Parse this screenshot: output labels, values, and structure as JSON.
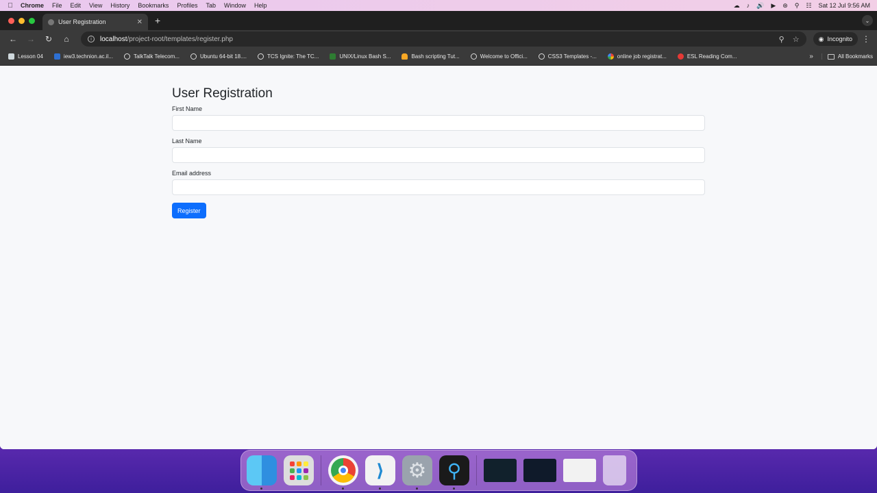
{
  "menubar": {
    "app": "Chrome",
    "items": [
      "File",
      "Edit",
      "View",
      "History",
      "Bookmarks",
      "Profiles",
      "Tab",
      "Window",
      "Help"
    ],
    "datetime": "Sat 12 Jul  9:56 AM"
  },
  "browser": {
    "tab_title": "User Registration",
    "url_host": "localhost",
    "url_path": "/project-root/templates/register.php",
    "incognito_label": "Incognito",
    "bookmarks": [
      "Lesson 04",
      "iew3.technion.ac.il...",
      "TalkTalk Telecom...",
      "Ubuntu 64-bit 18....",
      "TCS Ignite: The TC...",
      "UNIX/Linux Bash S...",
      "Bash scripting Tut...",
      "Welcome to Offici...",
      "CSS3 Templates -...",
      "online job registrat...",
      "ESL Reading Com..."
    ],
    "all_bookmarks_label": "All Bookmarks"
  },
  "form": {
    "title": "User Registration",
    "first_name_label": "First Name",
    "first_name_value": "",
    "last_name_label": "Last Name",
    "last_name_value": "",
    "email_label": "Email address",
    "email_value": "",
    "submit_label": "Register"
  },
  "colors": {
    "primary_button": "#0d6efd",
    "page_background": "#f7f8fa",
    "browser_chrome": "#3a3a3a"
  }
}
